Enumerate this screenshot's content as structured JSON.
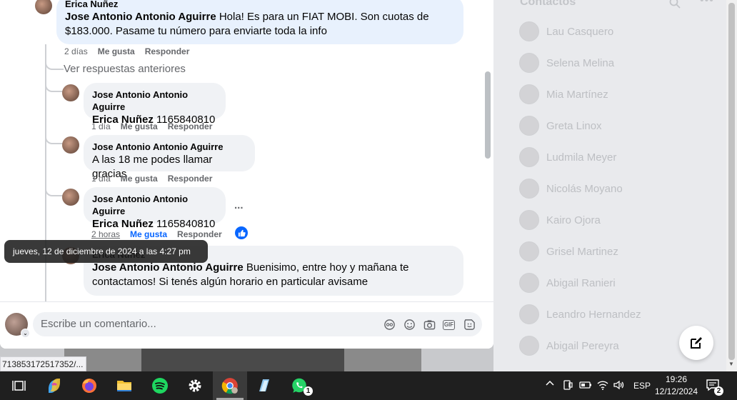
{
  "comments": [
    {
      "author": "Erica Nuñez",
      "mention": "Jose Antonio Antonio Aguirre",
      "text": "Hola! Es para un FIAT MOBI. Son cuotas de $183.000. Pasame tu número para enviarte toda la info",
      "time": "2 días",
      "like": "Me gusta",
      "reply": "Responder"
    },
    {
      "author": "Jose Antonio Antonio Aguirre",
      "mention": "Erica Nuñez",
      "text": "1165840810",
      "time": "1 día",
      "like": "Me gusta",
      "reply": "Responder"
    },
    {
      "author": "Jose Antonio Antonio Aguirre",
      "mention": "",
      "text": "A las 18 me podes llamar gracias",
      "time": "1 día",
      "like": "Me gusta",
      "reply": "Responder"
    },
    {
      "author": "Jose Antonio Antonio Aguirre",
      "mention": "Erica Nuñez",
      "text": "1165840810",
      "time": "2 horas",
      "like": "Me gusta",
      "reply": "Responder",
      "more": "..."
    },
    {
      "author": "Erica Nuñez",
      "mention": "Jose Antonio Antonio Aguirre",
      "text": "Buenisimo, entre hoy y mañana te contactamos! Si tenés algún horario en particular avisame"
    }
  ],
  "view_previous": "Ver respuestas anteriores",
  "tooltip": "jueves, 12 de diciembre de 2024 a las 4:27 pm",
  "composer": {
    "placeholder": "Escribe un comentario..."
  },
  "status_url": "713853172517352/...",
  "contacts": {
    "title": "Contactos",
    "items": [
      "Lau Casquero",
      "Selena Melina",
      "Mia Martínez",
      "Greta Linox",
      "Ludmila Meyer",
      "Nicolás Moyano",
      "Kairo Ojora",
      "Grisel Martinez",
      "Abigail Ranieri",
      "Leandro Hernandez",
      "Abigail Pereyra"
    ]
  },
  "taskbar": {
    "apps": [
      "task-view",
      "copilot",
      "firefox",
      "file-explorer",
      "spotify",
      "settings",
      "chrome",
      "notepad",
      "whatsapp"
    ],
    "whatsapp_badge": "1",
    "language": "ESP",
    "time": "19:26",
    "date": "12/12/2024",
    "notifications": "2"
  },
  "colors": {
    "accent": "#0866ff",
    "bubble": "#f0f2f5",
    "bubble_highlight": "#e8f1fd"
  }
}
